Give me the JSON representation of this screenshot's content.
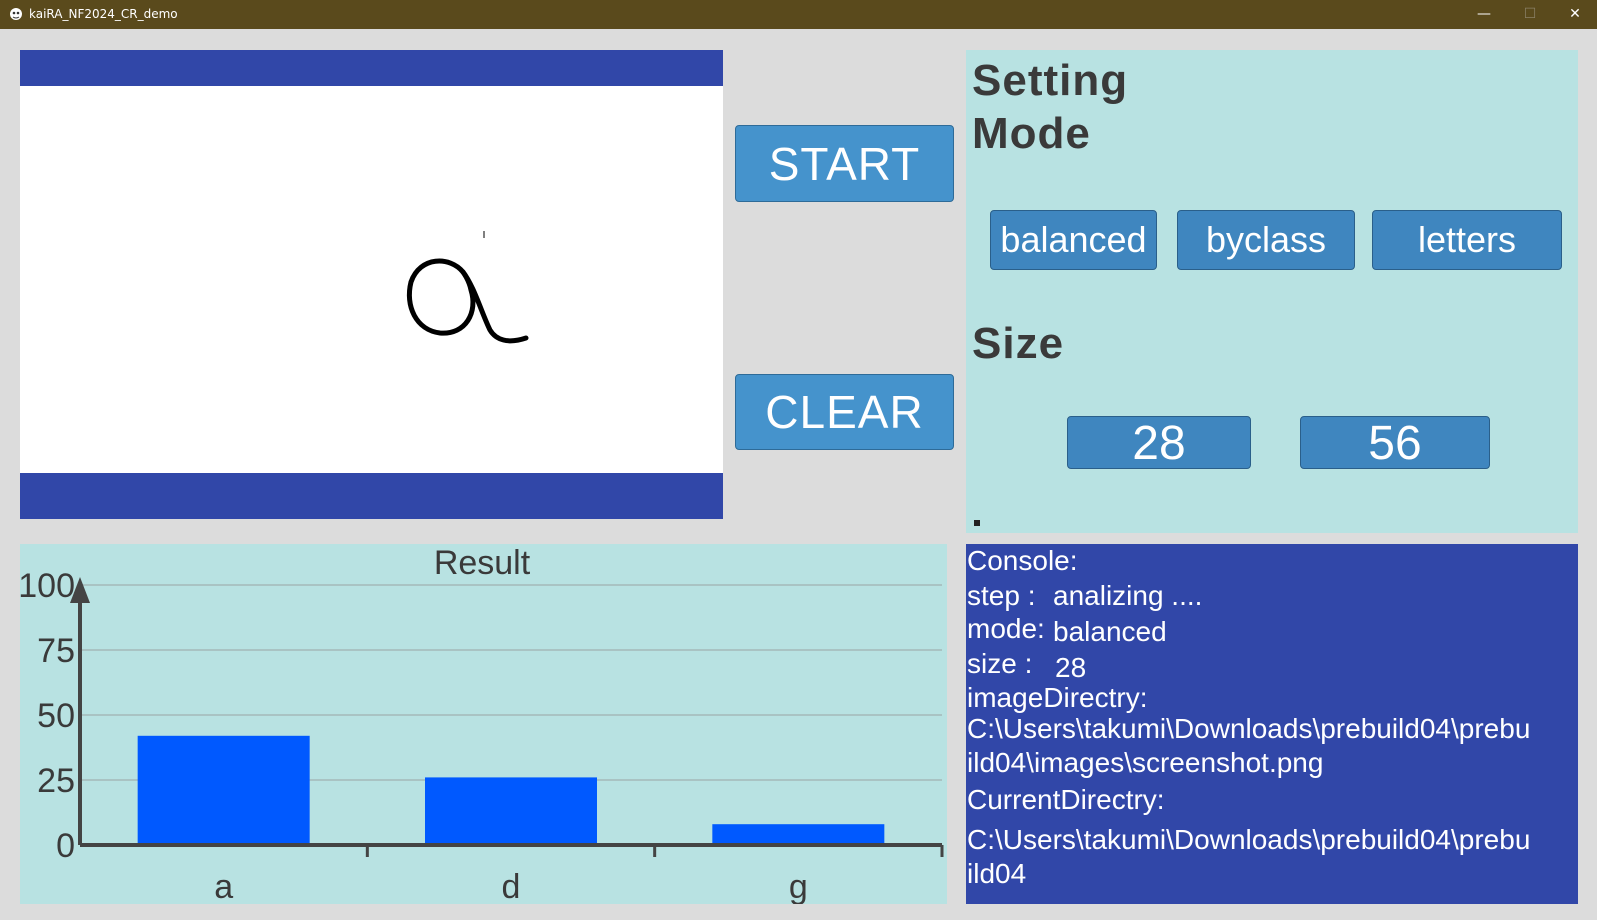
{
  "window": {
    "title": "kaiRA_NF2024_CR_demo",
    "minimize_glyph": "—",
    "maximize_glyph": "☐",
    "close_glyph": "✕"
  },
  "buttons": {
    "start": "START",
    "clear": "CLEAR"
  },
  "settings": {
    "title_line1": "Setting",
    "title_line2": "Mode",
    "mode_options": [
      "balanced",
      "byclass",
      "letters"
    ],
    "size_title": "Size",
    "size_options": [
      "28",
      "56"
    ],
    "footer_mark": "."
  },
  "console": {
    "header": "Console:",
    "step_label": "step  :",
    "step_value": "analizing ....",
    "mode_label": "mode:",
    "mode_value": "balanced",
    "size_label": "size  :",
    "size_value": "28",
    "image_dir_label": "imageDirectry:",
    "image_dir_line1": "C:\\Users\\takumi\\Downloads\\prebuild04\\prebu",
    "image_dir_line2": "ild04\\images\\screenshot.png",
    "current_dir_label": "CurrentDirectry:",
    "current_dir_line1": "C:\\Users\\takumi\\Downloads\\prebuild04\\prebu",
    "current_dir_line2": "ild04"
  },
  "colors": {
    "bar": "#0059ff",
    "panel": "#b8e2e2",
    "accent_blue": "#3147a8",
    "button": "#4593cc"
  },
  "chart_data": {
    "type": "bar",
    "title": "Result",
    "categories": [
      "a",
      "d",
      "g"
    ],
    "values": [
      42,
      26,
      8
    ],
    "ylim": [
      0,
      100
    ],
    "yticks": [
      0,
      25,
      50,
      75,
      100
    ],
    "grid": true,
    "xlabel": "",
    "ylabel": ""
  }
}
